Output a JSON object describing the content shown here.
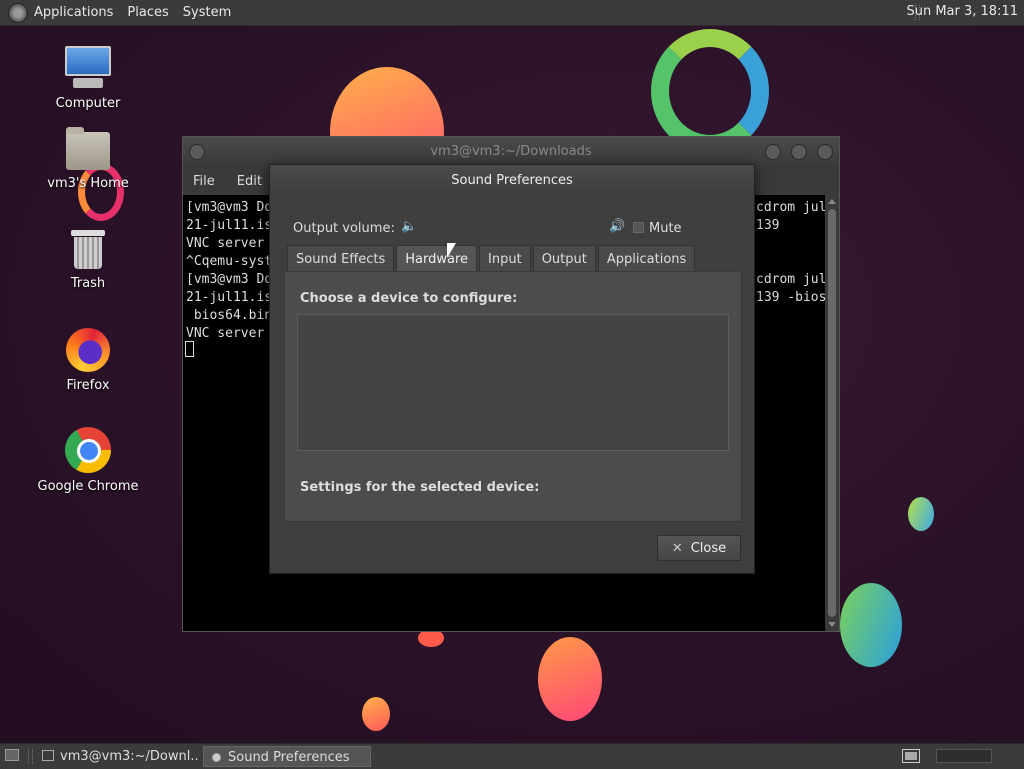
{
  "top_panel": {
    "menus": [
      "Applications",
      "Places",
      "System"
    ],
    "clock": "Sun Mar 3, 18:11"
  },
  "desktop_icons": [
    {
      "label": "Computer",
      "icon": "computer-icon"
    },
    {
      "label": "vm3's Home",
      "icon": "home-folder-icon"
    },
    {
      "label": "Trash",
      "icon": "trash-icon"
    },
    {
      "label": "Firefox",
      "icon": "firefox-icon"
    },
    {
      "label": "Google Chrome",
      "icon": "chrome-icon"
    }
  ],
  "terminal": {
    "title": "vm3@vm3:~/Downloads",
    "menu": [
      "File",
      "Edit"
    ],
    "lines_left": [
      "[vm3@vm3 Do",
      "21-jul11.is",
      "VNC server ",
      "^Cqemu-syst",
      "[vm3@vm3 Do",
      "21-jul11.is",
      " bios64.bin",
      "VNC server "
    ],
    "lines_right": [
      "cdrom jul",
      "139",
      "",
      "",
      "cdrom jul",
      "139 -bios",
      "",
      ""
    ]
  },
  "dialog": {
    "title": "Sound Preferences",
    "output_volume_label": "Output volume:",
    "mute_label": "Mute",
    "mute_checked": false,
    "tabs": [
      "Sound Effects",
      "Hardware",
      "Input",
      "Output",
      "Applications"
    ],
    "active_tab": "Hardware",
    "choose_device_label": "Choose a device to configure:",
    "settings_label": "Settings for the selected device:",
    "close_label": "Close"
  },
  "taskbar": {
    "tasks": [
      {
        "label": "vm3@vm3:~/Downl...",
        "active": false
      },
      {
        "label": "Sound Preferences",
        "active": true
      }
    ]
  },
  "colors": {
    "panel": "#3b3b3b",
    "dialog_bg": "#3f3f3f",
    "terminal_bg": "#000000"
  }
}
